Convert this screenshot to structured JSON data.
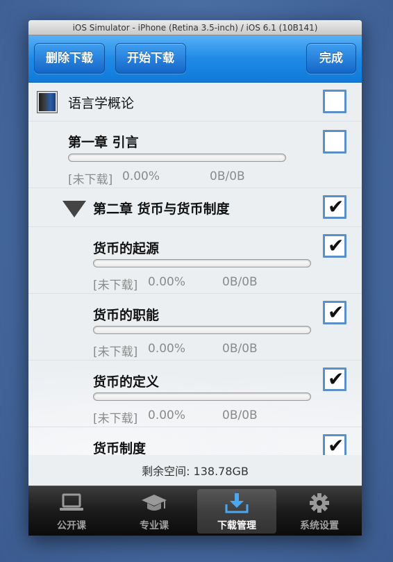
{
  "window": {
    "title": "iOS Simulator - iPhone (Retina 3.5-inch) / iOS 6.1 (10B141)"
  },
  "navbar": {
    "delete_label": "删除下载",
    "start_label": "开始下载",
    "done_label": "完成"
  },
  "list": {
    "course": {
      "title": "语言学概论",
      "checked": false,
      "icon": "book-icon"
    },
    "items": [
      {
        "title": "第一章 引言",
        "status": "[未下载]",
        "percent": "0.00%",
        "size": "0B/0B",
        "progress": 0,
        "checked": false
      },
      {
        "title": "第二章 货币与货币制度",
        "checked": true,
        "icon": "disclosure-triangle-icon"
      },
      {
        "title": "货币的起源",
        "status": "[未下载]",
        "percent": "0.00%",
        "size": "0B/0B",
        "progress": 0,
        "checked": true
      },
      {
        "title": "货币的职能",
        "status": "[未下载]",
        "percent": "0.00%",
        "size": "0B/0B",
        "progress": 0,
        "checked": true
      },
      {
        "title": "货币的定义",
        "status": "[未下载]",
        "percent": "0.00%",
        "size": "0B/0B",
        "progress": 0,
        "checked": true
      },
      {
        "title": "货币制度",
        "checked": true
      }
    ],
    "check_glyph": "✔"
  },
  "footer": {
    "free_space": "剩余空间: 138.78GB"
  },
  "tabbar": {
    "tabs": [
      {
        "label": "公开课",
        "icon": "laptop-icon",
        "selected": false
      },
      {
        "label": "专业课",
        "icon": "graduation-cap-icon",
        "selected": false
      },
      {
        "label": "下载管理",
        "icon": "download-icon",
        "selected": true
      },
      {
        "label": "系统设置",
        "icon": "gear-icon",
        "selected": false
      }
    ]
  },
  "colors": {
    "nav_blue": "#1f8ae6",
    "checkbox_border": "#5a8fc8",
    "download_icon": "#4aa8f0"
  }
}
